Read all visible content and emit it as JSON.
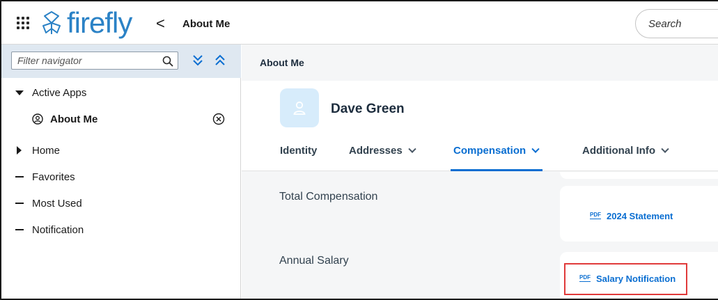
{
  "shell": {
    "brand": "firefly",
    "back_glyph": "<",
    "app_title": "About Me",
    "search_placeholder": "Search"
  },
  "navigator": {
    "filter_placeholder": "Filter navigator",
    "items": [
      {
        "label": "Active Apps",
        "state": "expanded"
      },
      {
        "label": "About Me",
        "icon": "person-circle-icon",
        "child": true
      },
      {
        "label": "Home",
        "state": "collapsed"
      },
      {
        "label": "Favorites",
        "state": "leaf"
      },
      {
        "label": "Most Used",
        "state": "leaf"
      },
      {
        "label": "Notification",
        "state": "leaf"
      }
    ]
  },
  "main": {
    "breadcrumb": "About Me",
    "person_name": "Dave Green",
    "tabs": [
      {
        "label": "Identity",
        "has_menu": false,
        "selected": false
      },
      {
        "label": "Addresses",
        "has_menu": true,
        "selected": false
      },
      {
        "label": "Compensation",
        "has_menu": true,
        "selected": true
      },
      {
        "label": "Additional Info",
        "has_menu": true,
        "selected": false
      }
    ],
    "sections": [
      {
        "label": "Total Compensation",
        "link": "2024 Statement"
      },
      {
        "label": "Annual Salary",
        "link": "Salary Notification"
      }
    ],
    "pdf_icon_text": "PDF"
  },
  "colors": {
    "brand": "#2b82c6",
    "accent": "#0a6ed1",
    "highlight": "#e03a3a",
    "nav_filter_bg": "#dfe8f1",
    "avatar_bg": "#d7ecfb"
  }
}
